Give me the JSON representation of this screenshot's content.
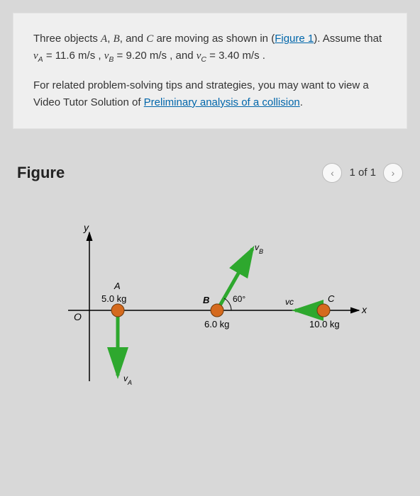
{
  "problem": {
    "text1a": "Three objects ",
    "objA": "A",
    "comma1": ", ",
    "objB": "B",
    "comma2": ", and ",
    "objC": "C",
    "text1b": " are moving as shown in (",
    "figlink": "Figure 1",
    "text1c": "). Assume that ",
    "vA": "v",
    "vAsub": "A",
    "eqA": " = 11.6 m/s , ",
    "vB": "v",
    "vBsub": "B",
    "eqB": " = 9.20 m/s , and ",
    "vC": "v",
    "vCsub": "C",
    "eqC": " = 3.40 m/s .",
    "text2a": "For related problem-solving tips and strategies, you may want to view a Video Tutor Solution of ",
    "link2": "Preliminary analysis of a collision",
    "text2b": "."
  },
  "figure": {
    "title": "Figure",
    "pager_text": "1 of 1",
    "prev": "‹",
    "next": "›",
    "labels": {
      "y": "y",
      "x": "x",
      "O": "O",
      "A": "A",
      "B": "B",
      "C": "C",
      "massA": "5.0 kg",
      "massB": "6.0 kg",
      "massC": "10.0 kg",
      "angle": "60°",
      "vA": "vA",
      "vB": "vB",
      "vC": "vc"
    }
  }
}
